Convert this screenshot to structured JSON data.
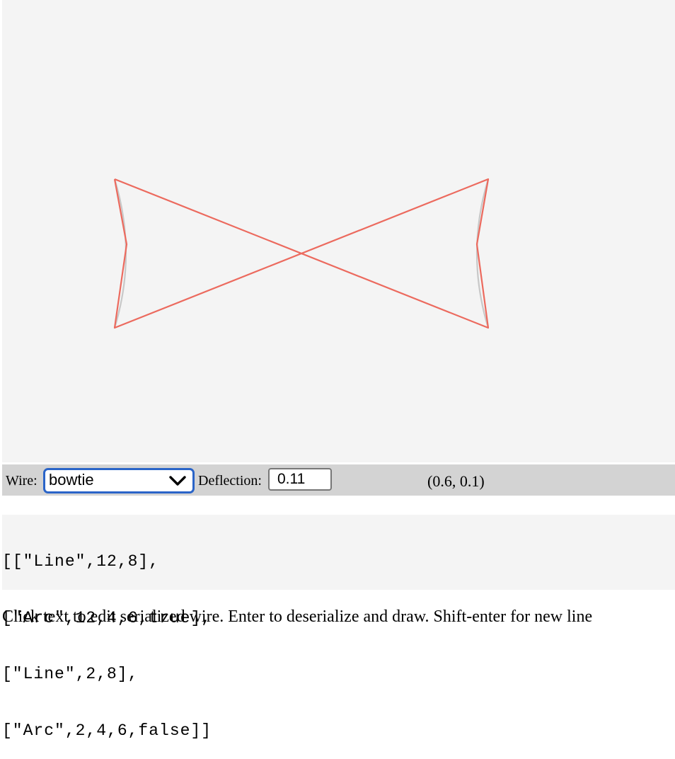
{
  "toolbar": {
    "wire_label": "Wire:",
    "wire_selected": "bowtie",
    "deflection_label": "Deflection:",
    "deflection_value": "0.11",
    "coordinate_readout": "(0.6, 0.1)"
  },
  "serialized_wire": {
    "lines": [
      "[[\"Line\",12,8],",
      "[\"Arc\",12,4,6,true],",
      "[\"Line\",2,8],",
      "[\"Arc\",2,4,6,false]]"
    ]
  },
  "help_text": "Click text to edit serialized wire. Enter to deserialize and draw. Shift-enter for new line",
  "colors": {
    "wire_polyline": "#ec6a5e",
    "arc_curve": "#c8c8c8",
    "canvas_bg": "#f4f4f4",
    "toolbar_bg": "#d3d3d3",
    "select_focus": "#2a64c8"
  }
}
